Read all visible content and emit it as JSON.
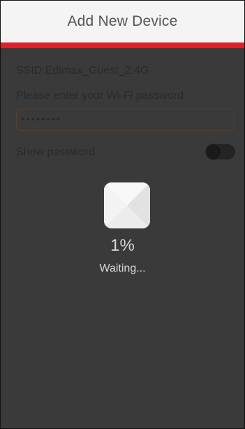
{
  "header": {
    "title": "Add New Device"
  },
  "colors": {
    "accent": "#d8232a",
    "background": "#3a3a3a",
    "header_background": "#f4f4f4"
  },
  "wifi": {
    "ssid_text": "SSID:Edimax_Guest_2.4G",
    "password_label": "Please enter your Wi-Fi password",
    "password_value": "••••••••",
    "show_password_label": "Show password",
    "show_password_enabled": false
  },
  "progress": {
    "icon": "device-icon",
    "percent_text": "1%",
    "percent": 1,
    "status_text": "Waiting..."
  }
}
